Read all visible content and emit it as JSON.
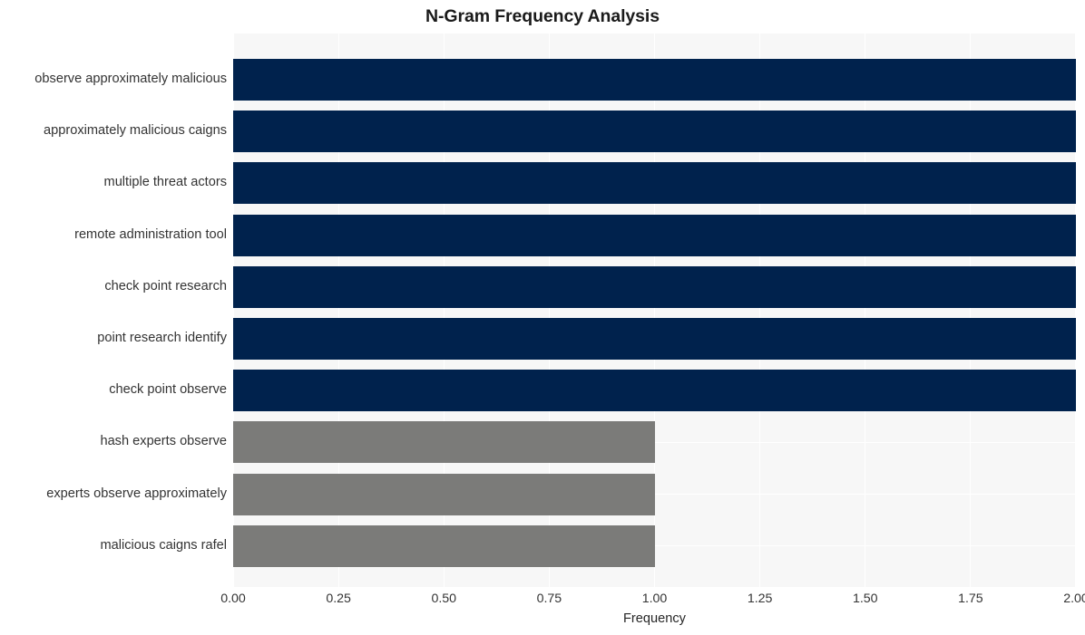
{
  "chart_data": {
    "type": "bar",
    "orientation": "horizontal",
    "title": "N-Gram Frequency Analysis",
    "xlabel": "Frequency",
    "ylabel": "",
    "xlim": [
      0,
      2
    ],
    "xticks": [
      "0.00",
      "0.25",
      "0.50",
      "0.75",
      "1.00",
      "1.25",
      "1.50",
      "1.75",
      "2.00"
    ],
    "xtick_values": [
      0,
      0.25,
      0.5,
      0.75,
      1,
      1.25,
      1.5,
      1.75,
      2
    ],
    "grid": true,
    "legend": "none",
    "categories": [
      "observe approximately malicious",
      "approximately malicious caigns",
      "multiple threat actors",
      "remote administration tool",
      "check point research",
      "point research identify",
      "check point observe",
      "hash experts observe",
      "experts observe approximately",
      "malicious caigns rafel"
    ],
    "values": [
      2,
      2,
      2,
      2,
      2,
      2,
      2,
      1,
      1,
      1
    ],
    "bar_colors": [
      "#00224d",
      "#00224d",
      "#00224d",
      "#00224d",
      "#00224d",
      "#00224d",
      "#00224d",
      "#7b7b79",
      "#7b7b79",
      "#7b7b79"
    ],
    "plot_background": "#f7f7f7",
    "figure_background": "#ffffff",
    "gridline_color": "#ffffff"
  }
}
